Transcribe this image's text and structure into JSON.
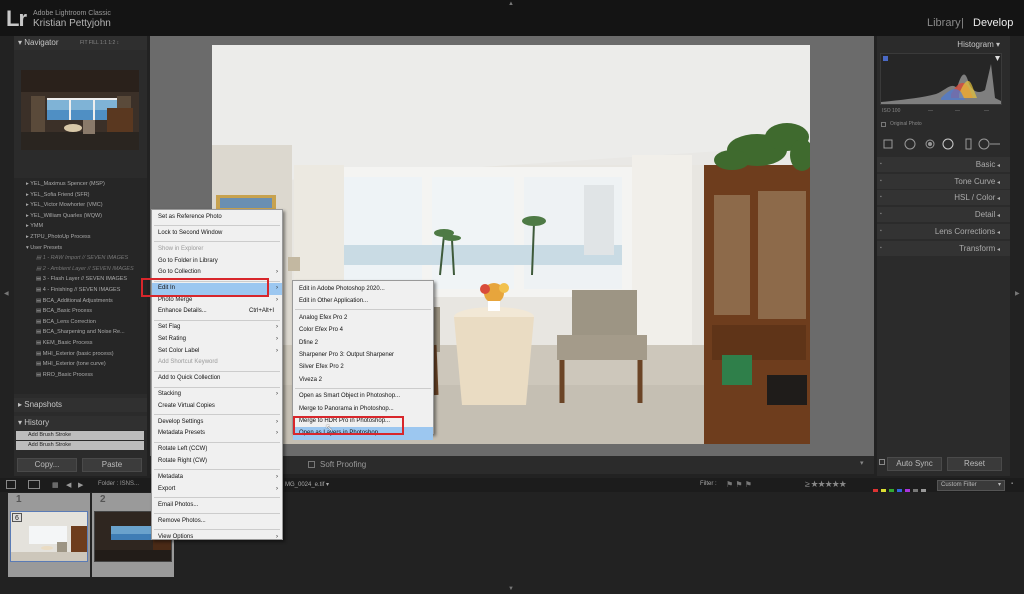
{
  "app": {
    "logo": "Lr",
    "name": "Adobe Lightroom Classic",
    "user": "Kristian Pettyjohn"
  },
  "modules": {
    "library": "Library",
    "separator": "|",
    "develop": "Develop"
  },
  "left_panel": {
    "navigator": {
      "title": "Navigator",
      "opts": "FIT   FILL   1:1   1:2 ↕"
    },
    "presets": [
      {
        "label": "YEL_Maximus Spencer (MSP)",
        "kind": "folder"
      },
      {
        "label": "YEL_Sofia Friend (SFR)",
        "kind": "folder"
      },
      {
        "label": "YEL_Victor Mowhorter (VMC)",
        "kind": "folder"
      },
      {
        "label": "YEL_William Quarles (WQW)",
        "kind": "folder"
      },
      {
        "label": "YMM",
        "kind": "folder"
      },
      {
        "label": "ZTPU_PhotoUp Process",
        "kind": "folder"
      },
      {
        "label": "User Presets",
        "kind": "group"
      },
      {
        "label": "1 - RAW Import // SEVEN IMAGES",
        "kind": "dim"
      },
      {
        "label": "2 - Ambient Layer // SEVEN IMAGES",
        "kind": "dim"
      },
      {
        "label": "3 - Flash Layer // SEVEN IMAGES",
        "kind": "item"
      },
      {
        "label": "4 - Finishing // SEVEN IMAGES",
        "kind": "item"
      },
      {
        "label": "BCA_Additional Adjustments",
        "kind": "item"
      },
      {
        "label": "BCA_Basic Process",
        "kind": "item"
      },
      {
        "label": "BCA_Lens Correction",
        "kind": "item"
      },
      {
        "label": "BCA_Sharpening and Noise Re...",
        "kind": "item"
      },
      {
        "label": "KEM_Basic Process",
        "kind": "item"
      },
      {
        "label": "MHI_Exterior (basic process)",
        "kind": "item"
      },
      {
        "label": "MHI_Exterior (tone curve)",
        "kind": "item"
      },
      {
        "label": "RRO_Basic Process",
        "kind": "item"
      }
    ],
    "snapshots": "Snapshots",
    "history": {
      "title": "History",
      "items": [
        "Add Brush Stroke",
        "Add Brush Stroke"
      ]
    },
    "copy": "Copy...",
    "paste": "Paste"
  },
  "right_panel": {
    "histogram": {
      "title": "Histogram",
      "iso": "ISO 100",
      "dash1": "—",
      "dash2": "—",
      "dash3": "—",
      "original": "Original Photo"
    },
    "sections": [
      "Basic",
      "Tone Curve",
      "HSL / Color",
      "Detail",
      "Lens Corrections",
      "Transform"
    ],
    "auto_sync": "Auto Sync",
    "reset": "Reset"
  },
  "toolbar": {
    "soft_proofing": "Soft Proofing"
  },
  "filmstrip": {
    "folder": "Folder : ISNS...",
    "file": "MG_0024_e.tif ▾",
    "filter": "Filter :",
    "stars": "≥ ★★★★★",
    "custom_filter": "Custom Filter",
    "cells": [
      {
        "num": "1",
        "badge": "6"
      },
      {
        "num": "2"
      }
    ]
  },
  "context_menu": {
    "items": [
      {
        "label": "Set as Reference Photo"
      },
      {
        "sep": true
      },
      {
        "label": "Lock to Second Window"
      },
      {
        "sep": true
      },
      {
        "label": "Show in Explorer",
        "disabled": true
      },
      {
        "label": "Go to Folder in Library"
      },
      {
        "label": "Go to Collection",
        "submenu": true
      },
      {
        "sep": true
      },
      {
        "label": "Edit In",
        "submenu": true,
        "highlight": true
      },
      {
        "label": "Photo Merge",
        "submenu": true
      },
      {
        "label": "Enhance Details...",
        "shortcut": "Ctrl+Alt+I"
      },
      {
        "sep": true
      },
      {
        "label": "Set Flag",
        "submenu": true
      },
      {
        "label": "Set Rating",
        "submenu": true
      },
      {
        "label": "Set Color Label",
        "submenu": true
      },
      {
        "label": "Add Shortcut Keyword",
        "disabled": true
      },
      {
        "sep": true
      },
      {
        "label": "Add to Quick Collection"
      },
      {
        "sep": true
      },
      {
        "label": "Stacking",
        "submenu": true
      },
      {
        "label": "Create Virtual Copies"
      },
      {
        "sep": true
      },
      {
        "label": "Develop Settings",
        "submenu": true
      },
      {
        "label": "Metadata Presets",
        "submenu": true
      },
      {
        "sep": true
      },
      {
        "label": "Rotate Left (CCW)"
      },
      {
        "label": "Rotate Right (CW)"
      },
      {
        "sep": true
      },
      {
        "label": "Metadata",
        "submenu": true
      },
      {
        "label": "Export",
        "submenu": true
      },
      {
        "sep": true
      },
      {
        "label": "Email Photos..."
      },
      {
        "sep": true
      },
      {
        "label": "Remove Photos..."
      },
      {
        "sep": true
      },
      {
        "label": "View Options",
        "submenu": true
      }
    ]
  },
  "edit_in_menu": {
    "items": [
      {
        "label": "Edit in Adobe Photoshop 2020..."
      },
      {
        "label": "Edit in Other Application..."
      },
      {
        "sep": true
      },
      {
        "label": "Analog Efex Pro 2"
      },
      {
        "label": "Color Efex Pro 4"
      },
      {
        "label": "Dfine 2"
      },
      {
        "label": "Sharpener Pro 3: Output Sharpener"
      },
      {
        "label": "Silver Efex Pro 2"
      },
      {
        "label": "Viveza 2"
      },
      {
        "sep": true
      },
      {
        "label": "Open as Smart Object in Photoshop..."
      },
      {
        "label": "Merge to Panorama in Photoshop..."
      },
      {
        "label": "Merge to HDR Pro in Photoshop..."
      },
      {
        "label": "Open as Layers in Photoshop...",
        "highlight": true
      }
    ]
  },
  "colors": {
    "highlight": "#9cc7f0",
    "annotation": "#d8262b",
    "panel": "#2b2b2b",
    "center": "#6b6b6b"
  }
}
